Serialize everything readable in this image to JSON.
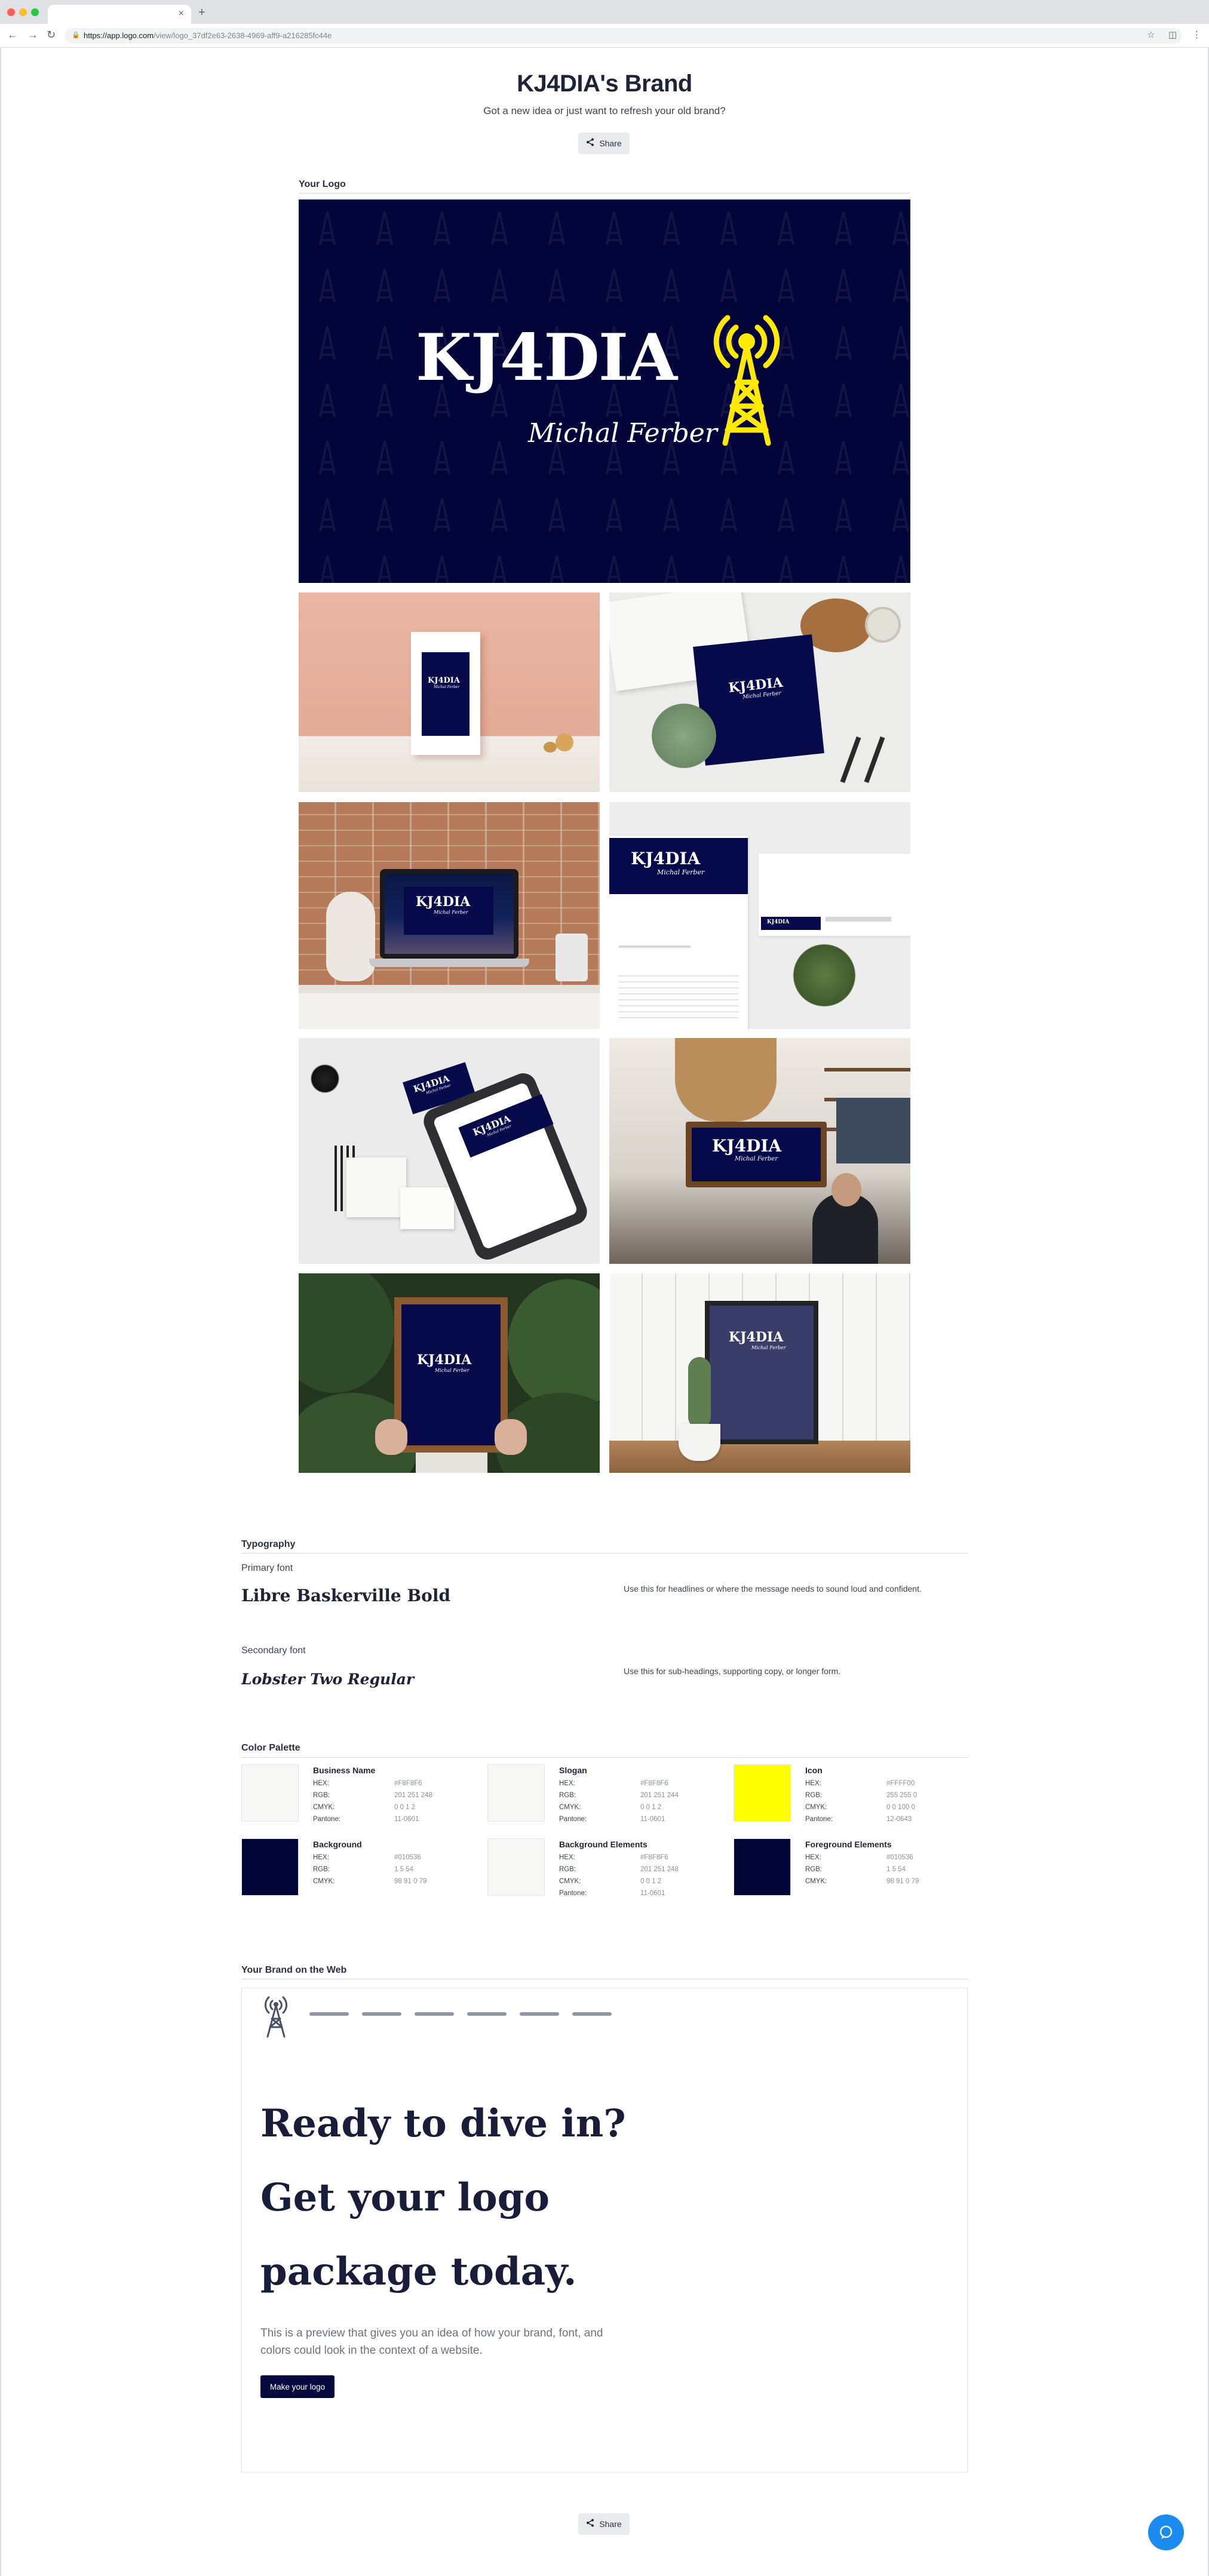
{
  "browser": {
    "url_host": "https://app.logo.com",
    "url_path": "/view/logo_37df2e63-2638-4969-aff9-a216285fc44e",
    "tab_close": "×",
    "new_tab": "+"
  },
  "header": {
    "title": "KJ4DIA's Brand",
    "subtitle": "Got a new idea or just want to refresh your old brand?",
    "share_label": "Share"
  },
  "logo_section": {
    "label": "Your Logo",
    "logo_name": "KJ4DIA",
    "logo_slogan": "Michal Ferber"
  },
  "mockups": [
    {
      "scene": "frame-on-shelf"
    },
    {
      "scene": "notebook-with-plants"
    },
    {
      "scene": "laptop-on-desk"
    },
    {
      "scene": "letterhead-and-card"
    },
    {
      "scene": "clipboard-stationery"
    },
    {
      "scene": "cafe-wall-sign"
    },
    {
      "scene": "hands-holding-frame"
    },
    {
      "scene": "framed-poster-cactus"
    }
  ],
  "typography": {
    "label": "Typography",
    "primary_title": "Primary font",
    "primary_font": "Libre Baskerville Bold",
    "primary_desc": "Use this for headlines or where the message needs to sound loud and confident.",
    "secondary_title": "Secondary font",
    "secondary_font": "Lobster Two Regular",
    "secondary_desc": "Use this for sub-headings, supporting copy, or longer form."
  },
  "palette": {
    "label": "Color Palette",
    "keys": {
      "hex": "HEX:",
      "rgb": "RGB:",
      "cmyk": "CMYK:",
      "pantone": "Pantone:"
    },
    "colors": [
      {
        "name": "Business Name",
        "hex": "#F8F8F6",
        "rgb": "201 251 248",
        "cmyk": "0 0 1 2",
        "pantone": "11-0601",
        "swatch": "#f8f8f6"
      },
      {
        "name": "Slogan",
        "hex": "#F8F8F6",
        "rgb": "201 251 244",
        "cmyk": "0 0 1 2",
        "pantone": "11-0601",
        "swatch": "#f8f8f6"
      },
      {
        "name": "Icon",
        "hex": "#FFFF00",
        "rgb": "255 255 0",
        "cmyk": "0 0 100 0",
        "pantone": "12-0643",
        "swatch": "#ffff00"
      },
      {
        "name": "Background",
        "hex": "#010536",
        "rgb": "1 5 54",
        "cmyk": "98 91 0 79",
        "swatch": "#010536"
      },
      {
        "name": "Background Elements",
        "hex": "#F8F8F6",
        "rgb": "201 251 248",
        "cmyk": "0 0 1 2",
        "pantone": "11-0601",
        "swatch": "#f8f8f6"
      },
      {
        "name": "Foreground Elements",
        "hex": "#010536",
        "rgb": "1 5 54",
        "cmyk": "98 91 0 79",
        "swatch": "#010536"
      }
    ]
  },
  "web": {
    "label": "Your Brand on the Web",
    "headline_1": "Ready to dive in?",
    "headline_2": "Get your logo",
    "headline_3": "package today.",
    "paragraph": "This is a preview that gives you an idea of how your brand, font, and colors could look in the context of a website.",
    "cta": "Make your logo"
  },
  "footer": {
    "share_label": "Share"
  },
  "colors": {
    "navy": "#03053a",
    "yellow": "#ffea00",
    "accent_blue": "#1a8cf0"
  }
}
